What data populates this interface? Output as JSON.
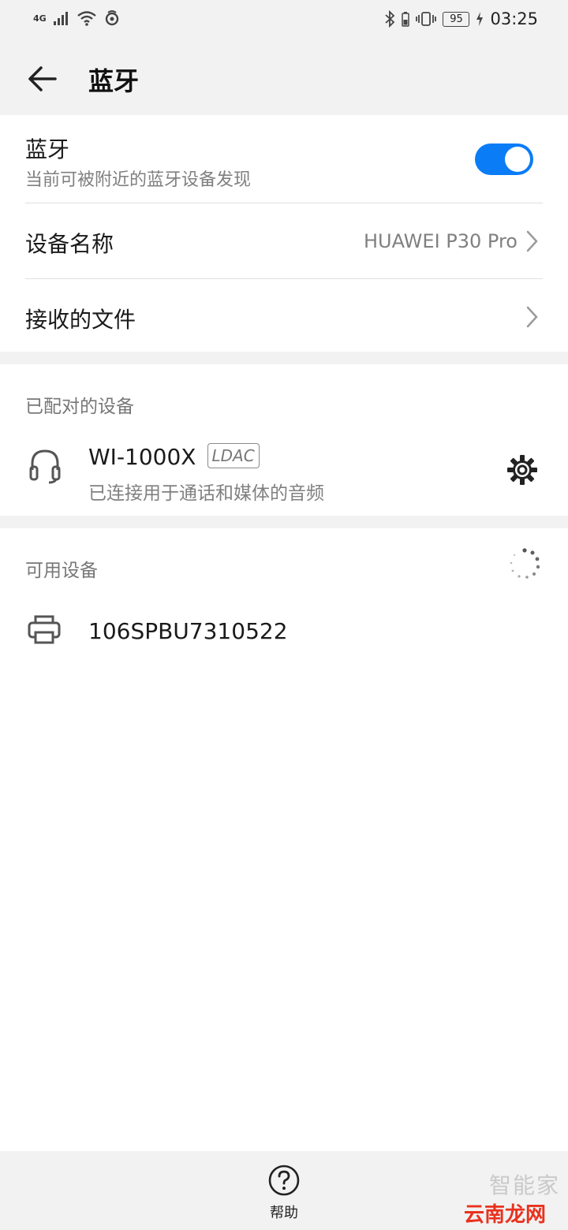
{
  "status_bar": {
    "network": "4G",
    "battery": "95",
    "time": "03:25"
  },
  "header": {
    "title": "蓝牙"
  },
  "bluetooth": {
    "label": "蓝牙",
    "subtitle": "当前可被附近的蓝牙设备发现",
    "enabled": true
  },
  "device_name": {
    "label": "设备名称",
    "value": "HUAWEI P30 Pro"
  },
  "received_files": {
    "label": "接收的文件"
  },
  "paired": {
    "section_title": "已配对的设备",
    "devices": [
      {
        "name": "WI-1000X",
        "badge": "LDAC",
        "status": "已连接用于通话和媒体的音频",
        "icon": "headset-icon"
      }
    ]
  },
  "available": {
    "section_title": "可用设备",
    "devices": [
      {
        "name": "106SPBU7310522",
        "icon": "printer-icon"
      }
    ]
  },
  "bottom": {
    "help_label": "帮助"
  },
  "watermark": {
    "top_text": "智能家",
    "bottom_text": "云南龙网"
  },
  "colors": {
    "accent": "#0a7cf6",
    "background": "#f2f2f2",
    "card": "#ffffff"
  }
}
